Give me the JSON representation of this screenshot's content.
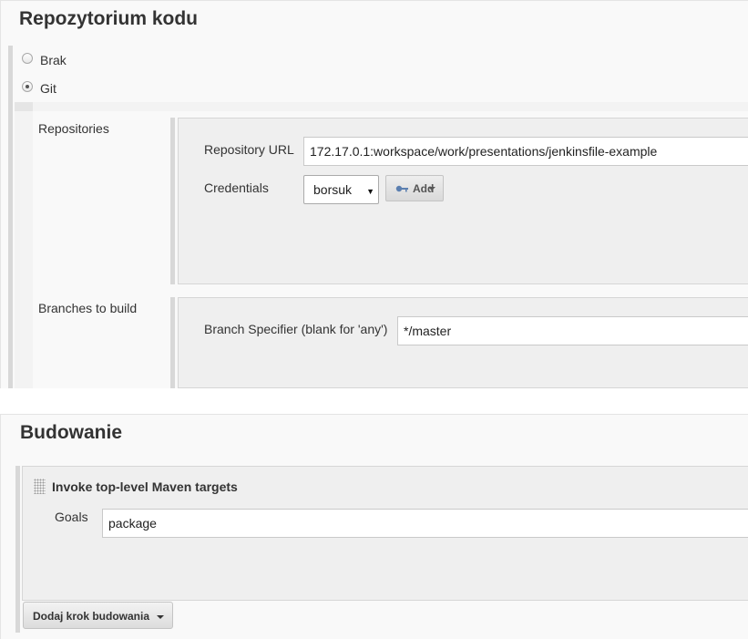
{
  "scm": {
    "title": "Repozytorium kodu",
    "options": [
      {
        "label": "Brak",
        "selected": false
      },
      {
        "label": "Git",
        "selected": true
      }
    ],
    "repositories_label": "Repositories",
    "repository_url_label": "Repository URL",
    "repository_url_value": "172.17.0.1:workspace/work/presentations/jenkinsfile-example",
    "credentials_label": "Credentials",
    "credentials_value": "borsuk",
    "add_button_label": "Add",
    "branches_label": "Branches to build",
    "branch_specifier_label": "Branch Specifier (blank for 'any')",
    "branch_specifier_value": "*/master"
  },
  "build": {
    "title": "Budowanie",
    "step_title": "Invoke top-level Maven targets",
    "goals_label": "Goals",
    "goals_value": "package",
    "add_step_button_label": "Dodaj krok budowania"
  },
  "icons": {
    "add_button_icon": "key-icon",
    "add_button_caret": "caret-down-icon",
    "select_arrow": "select-arrow-icon",
    "step_handle": "drag-handle-icon"
  },
  "colors": {
    "section_bg": "#f9f9f9",
    "panel_bg": "#efefef",
    "key_icon": "#5b7fb0"
  }
}
